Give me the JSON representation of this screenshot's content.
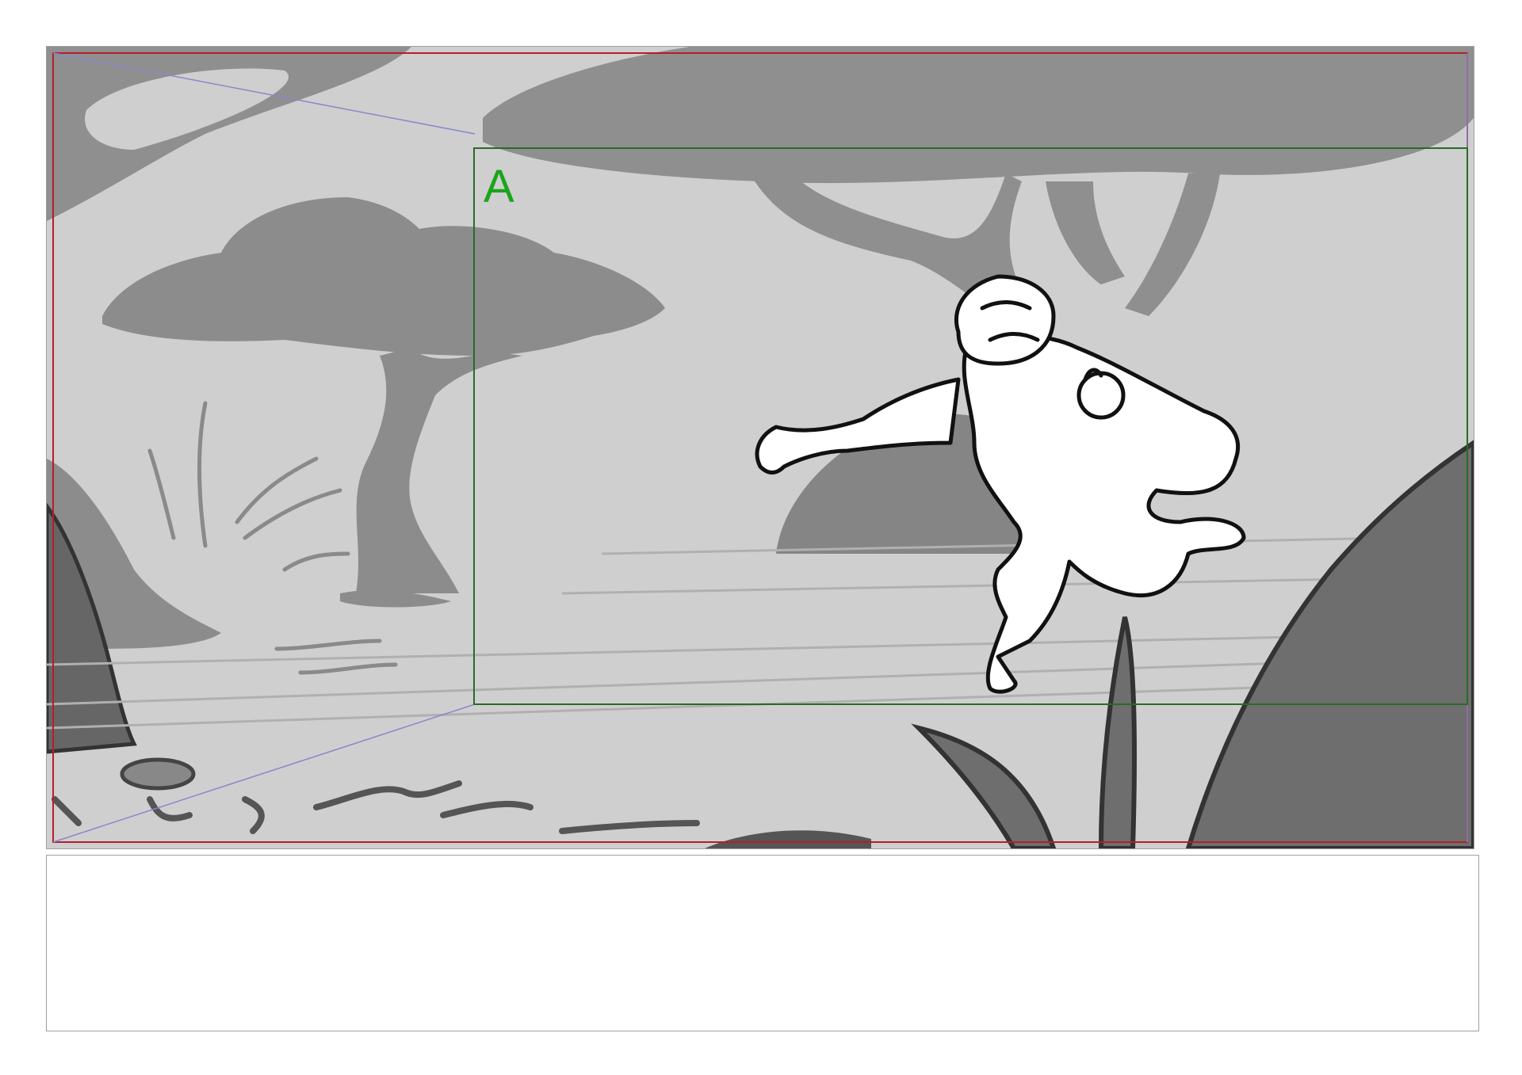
{
  "storyboard": {
    "panel": {
      "camera_field_label": "A",
      "colors": {
        "background": "#cfcfcf",
        "midtone": "#8c8c8c",
        "dark": "#666666",
        "safe_frame": "#b0202a",
        "camera_field": "#2a6a2a",
        "camera_label": "#1aa51a",
        "guide_line": "#8888cc",
        "lineart": "#111111"
      }
    },
    "notes": {
      "text": ""
    }
  }
}
